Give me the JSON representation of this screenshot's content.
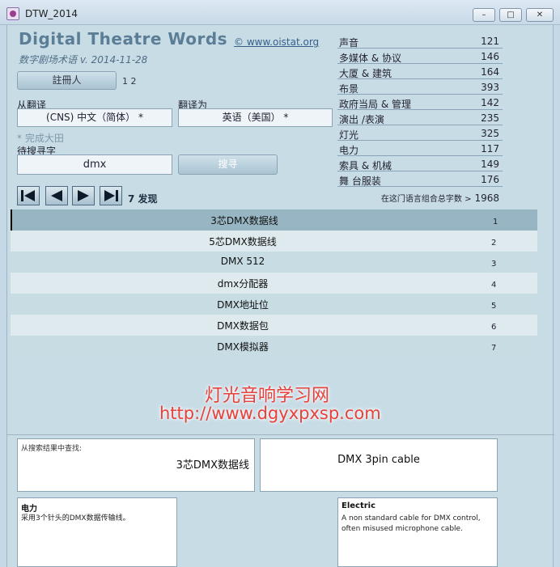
{
  "window": {
    "title": "DTW_2014"
  },
  "header": {
    "title": "Digital Theatre Words",
    "link": "© www.oistat.org",
    "subtitle": "数字剧场术语 v. 2014-11-28"
  },
  "register": {
    "label": "註冊人",
    "count": "1 2"
  },
  "lang": {
    "from_label": "从翻译",
    "from_value": "(CNS) 中文（简体） *",
    "to_label": "翻译为",
    "to_value": "英语（美国） *"
  },
  "search": {
    "hint": "* 完成大田",
    "label": "待搜寻字",
    "value": "dmx",
    "button": "搜寻"
  },
  "nav": {
    "found": "7 发现"
  },
  "categories": [
    {
      "name": "声音",
      "count": "121"
    },
    {
      "name": "多媒体 & 协议",
      "count": "146"
    },
    {
      "name": "大厦 & 建筑",
      "count": "164"
    },
    {
      "name": "布景",
      "count": "393"
    },
    {
      "name": "政府当局 & 管理",
      "count": "142"
    },
    {
      "name": "演出 /表演",
      "count": "235"
    },
    {
      "name": "灯光",
      "count": "325"
    },
    {
      "name": "电力",
      "count": "117"
    },
    {
      "name": "索具 & 机械",
      "count": "149"
    },
    {
      "name": "舞 台服装",
      "count": "176"
    }
  ],
  "total": {
    "label": "在这门语言组合总字数 >",
    "value": "1968"
  },
  "results": [
    {
      "term": "3芯DMX数据线",
      "num": "1"
    },
    {
      "term": "5芯DMX数据线",
      "num": "2"
    },
    {
      "term": "DMX 512",
      "num": "3"
    },
    {
      "term": "dmx分配器",
      "num": "4"
    },
    {
      "term": "DMX地址位",
      "num": "5"
    },
    {
      "term": "DMX数据包",
      "num": "6"
    },
    {
      "term": "DMX模拟器",
      "num": "7"
    }
  ],
  "watermark": {
    "line1": "灯光音响学习网",
    "line2": "http://www.dgyxpxsp.com"
  },
  "detail": {
    "source_caption": "从搜索结果中查找:",
    "source_term": "3芯DMX数据线",
    "target_term": "DMX 3pin cable",
    "source_category": "电力",
    "source_definition": "采用3个针头的DMX数据传输线。",
    "target_category": "Electric",
    "target_definition": "A non standard cable for DMX control, often misused microphone cable."
  },
  "colors": {
    "accent": "#5b7d95",
    "selected_row": "#97b5c2",
    "watermark": "#e8403a"
  }
}
